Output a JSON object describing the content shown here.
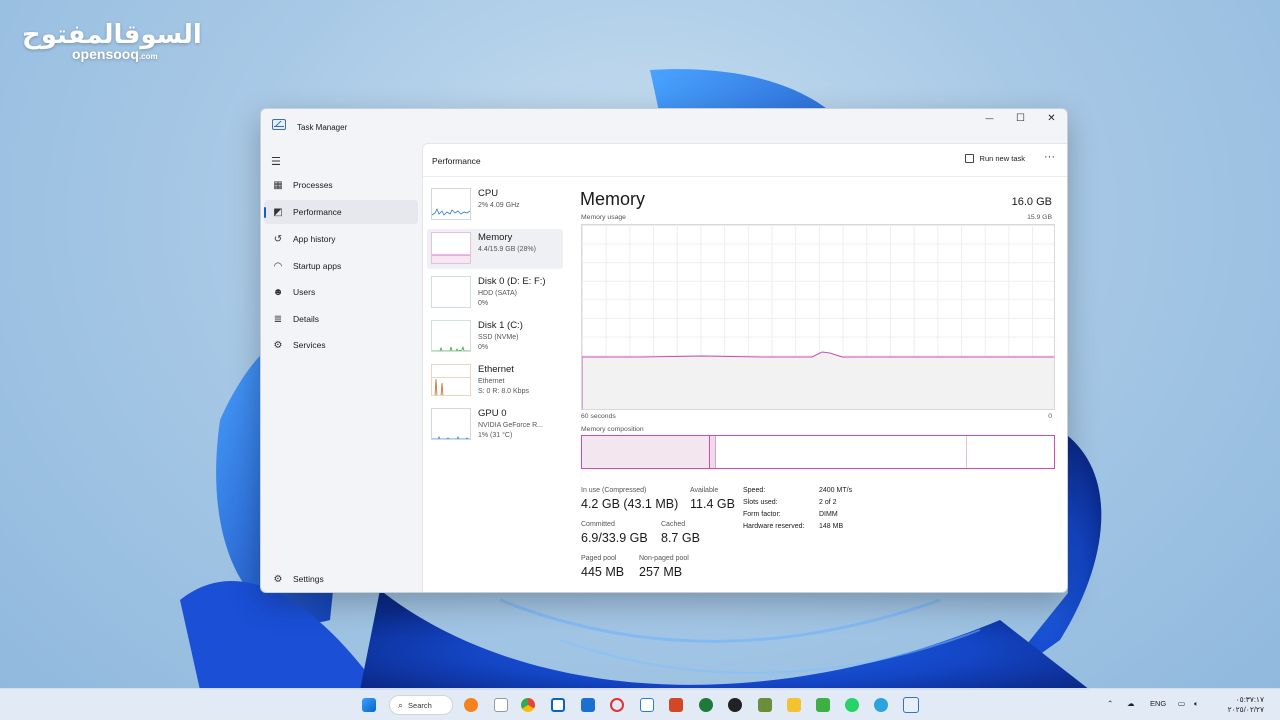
{
  "watermark": {
    "arabic": "السوقالمفتوح",
    "latin": "opensooq",
    "domain": ".com"
  },
  "window": {
    "title": "Task Manager",
    "controls": {
      "minimize": "—",
      "maximize": "☐",
      "close": "✕"
    }
  },
  "sidebar": {
    "items": [
      {
        "label": "Processes",
        "icon": "processes-icon"
      },
      {
        "label": "Performance",
        "icon": "performance-icon",
        "active": true
      },
      {
        "label": "App history",
        "icon": "app-history-icon"
      },
      {
        "label": "Startup apps",
        "icon": "startup-apps-icon"
      },
      {
        "label": "Users",
        "icon": "users-icon"
      },
      {
        "label": "Details",
        "icon": "details-icon"
      },
      {
        "label": "Services",
        "icon": "services-icon"
      }
    ],
    "settings": "Settings"
  },
  "header": {
    "title": "Performance",
    "run_new_task": "Run new task",
    "more": "···"
  },
  "devices": [
    {
      "name": "CPU",
      "line1": "2% 4.09 GHz",
      "line2": ""
    },
    {
      "name": "Memory",
      "line1": "4.4/15.9 GB (28%)",
      "line2": ""
    },
    {
      "name": "Disk 0 (D: E: F:)",
      "line1": "HDD (SATA)",
      "line2": "0%"
    },
    {
      "name": "Disk 1 (C:)",
      "line1": "SSD (NVMe)",
      "line2": "0%"
    },
    {
      "name": "Ethernet",
      "line1": "Ethernet",
      "line2": "S: 0 R: 8.0 Kbps"
    },
    {
      "name": "GPU 0",
      "line1": "NVIDIA GeForce R...",
      "line2": "1% (31 °C)"
    }
  ],
  "memory": {
    "title": "Memory",
    "total": "16.0 GB",
    "usage_label": "Memory usage",
    "usage_max": "15.9 GB",
    "axis_left": "60 seconds",
    "axis_right": "0",
    "composition_label": "Memory composition",
    "stats": {
      "in_use_k": "In use (Compressed)",
      "in_use_v": "4.2 GB (43.1 MB)",
      "available_k": "Available",
      "available_v": "11.4 GB",
      "committed_k": "Committed",
      "committed_v": "6.9/33.9 GB",
      "cached_k": "Cached",
      "cached_v": "8.7 GB",
      "paged_k": "Paged pool",
      "paged_v": "445 MB",
      "nonpaged_k": "Non-paged pool",
      "nonpaged_v": "257 MB"
    },
    "specs": {
      "speed_k": "Speed:",
      "speed_v": "2400 MT/s",
      "slots_k": "Slots used:",
      "slots_v": "2 of 2",
      "form_k": "Form factor:",
      "form_v": "DIMM",
      "hw_k": "Hardware reserved:",
      "hw_v": "148 MB"
    }
  },
  "taskbar": {
    "search": "Search",
    "lang": "ENG",
    "time": "٠٥:٣٧:١٧",
    "date": "٢٠٢٥/٠٢/٢٧"
  },
  "colors": {
    "accent": "#0a64c8",
    "memory_line": "#cc4bb5",
    "cpu_line": "#2b7cd3",
    "disk_line": "#3fa34d",
    "eth_line": "#c46a1f"
  }
}
